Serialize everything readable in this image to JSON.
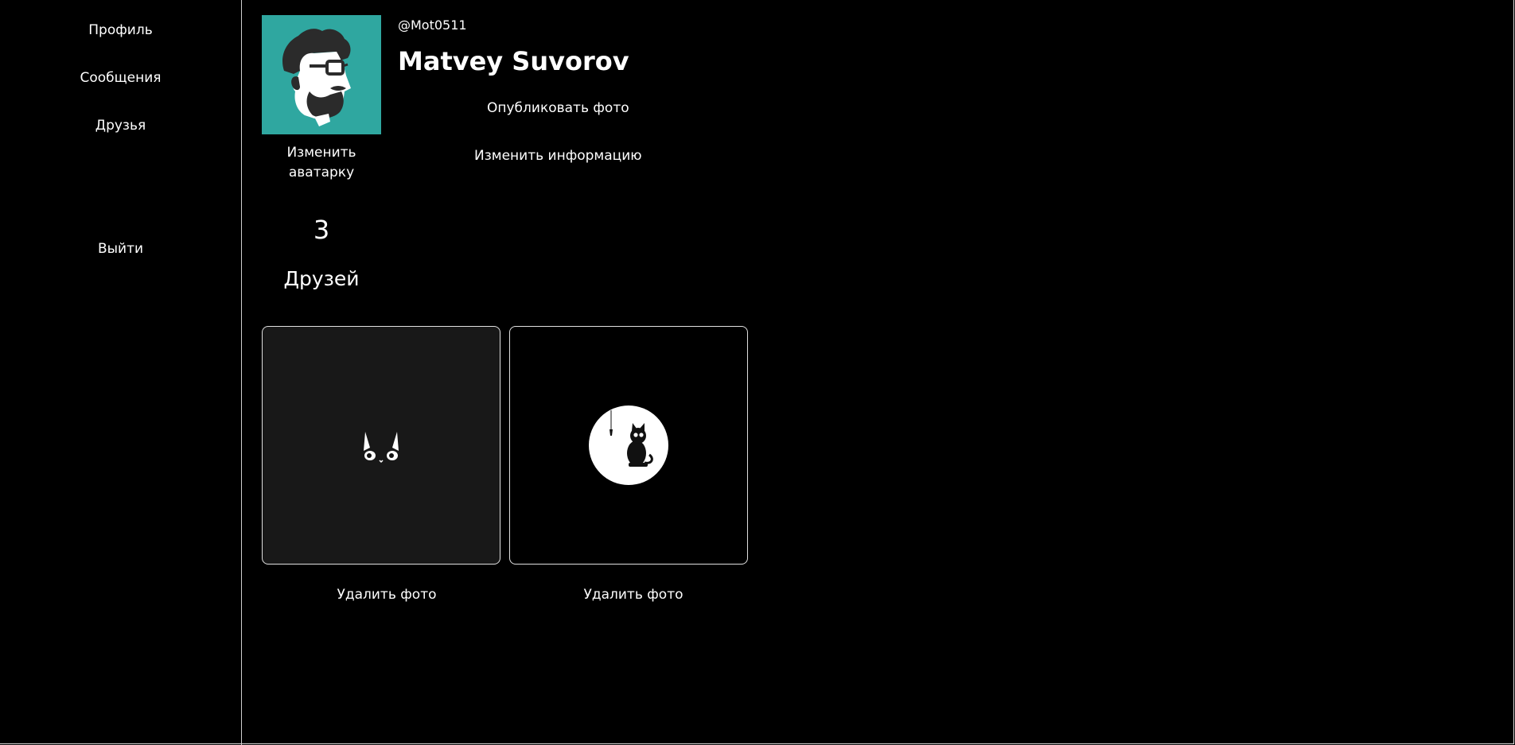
{
  "sidebar": {
    "items": [
      {
        "label": "Профиль"
      },
      {
        "label": "Сообщения"
      },
      {
        "label": "Друзья"
      }
    ],
    "logout_label": "Выйти"
  },
  "profile": {
    "username": "@Mot0511",
    "fullname": "Matvey Suvorov",
    "avatar_icon": "bearded-man-avatar",
    "avatar_bg": "#2fa7a0",
    "change_avatar_label": "Изменить аватарку",
    "publish_photo_label": "Опубликовать фото",
    "edit_info_label": "Изменить информацию"
  },
  "stats": {
    "friends_count": "3",
    "friends_label": "Друзей"
  },
  "photos": [
    {
      "icon": "cat-peeking-icon",
      "delete_label": "Удалить фото"
    },
    {
      "icon": "cat-fishing-moon-icon",
      "delete_label": "Удалить фото"
    }
  ]
}
